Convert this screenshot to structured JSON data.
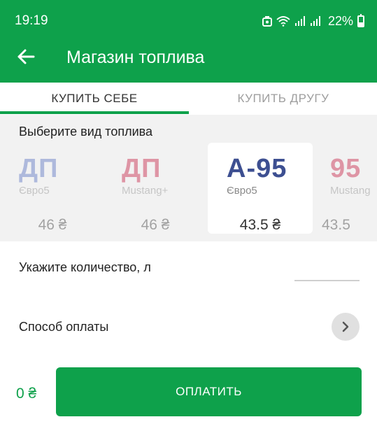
{
  "status_bar": {
    "time": "19:19",
    "battery": "22%"
  },
  "header": {
    "title": "Магазин топлива"
  },
  "tabs": [
    {
      "label": "КУПИТЬ СЕБЕ",
      "active": true
    },
    {
      "label": "КУПИТЬ ДРУГУ",
      "active": false
    }
  ],
  "fuel_section": {
    "label": "Выберите вид топлива",
    "fuels": [
      {
        "name": "ДП",
        "sub": "Євро5",
        "price": "46 ₴",
        "color": "#6c82c8",
        "selected": false
      },
      {
        "name": "ДП",
        "sub": "Mustang+",
        "price": "46 ₴",
        "color": "#cc3b5a",
        "selected": false
      },
      {
        "name": "А-95",
        "sub": "Євро5",
        "price": "43.5 ₴",
        "color": "#3d4f91",
        "selected": true
      },
      {
        "name": "95",
        "sub": "Mustang",
        "price": "43.5",
        "color": "#cc3b5a",
        "selected": false
      }
    ]
  },
  "quantity": {
    "label": "Укажите количество, л",
    "value": "",
    "placeholder": ""
  },
  "payment": {
    "label": "Способ оплаты"
  },
  "footer": {
    "total": "0 ₴",
    "pay_label": "ОПЛАТИТЬ"
  },
  "colors": {
    "brand": "#0ea14b",
    "fuel_section_bg": "#f2f2f2"
  }
}
